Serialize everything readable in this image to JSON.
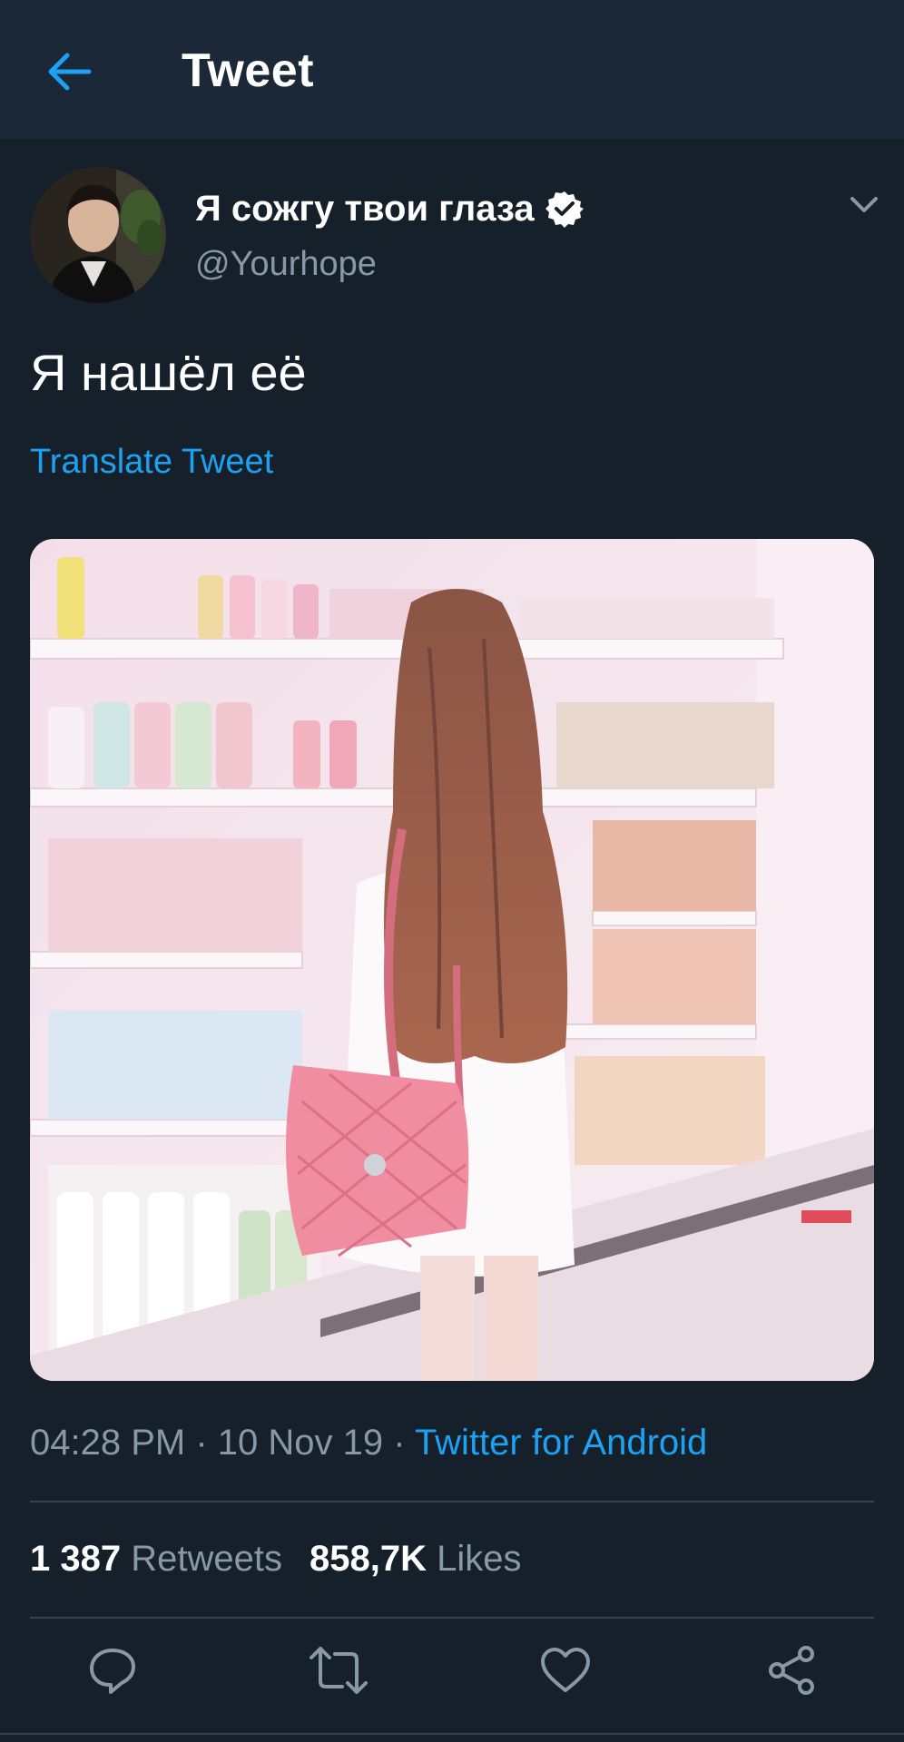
{
  "header": {
    "title": "Tweet",
    "back_icon": "arrow-left-icon"
  },
  "author": {
    "display_name": "Я сожгу твои глаза",
    "handle": "@Yourhope",
    "verified": true
  },
  "tweet": {
    "text": "Я нашёл её",
    "translate_label": "Translate Tweet",
    "media_icon": "photo-supermarket-girl-pink-bag"
  },
  "meta": {
    "time": "04:28 PM",
    "sep1": " · ",
    "date": "10 Nov 19",
    "sep2": " · ",
    "source": "Twitter for Android"
  },
  "stats": {
    "retweets_count": "1 387",
    "retweets_label": "Retweets",
    "likes_count": "858,7K",
    "likes_label": "Likes"
  },
  "actions": {
    "reply_icon": "reply-icon",
    "retweet_icon": "retweet-icon",
    "like_icon": "heart-icon",
    "share_icon": "share-icon"
  },
  "colors": {
    "background": "#15202b",
    "header": "#1b2837",
    "accent": "#1da1f2",
    "secondary_text": "#8899a6",
    "divider": "#38444d"
  }
}
